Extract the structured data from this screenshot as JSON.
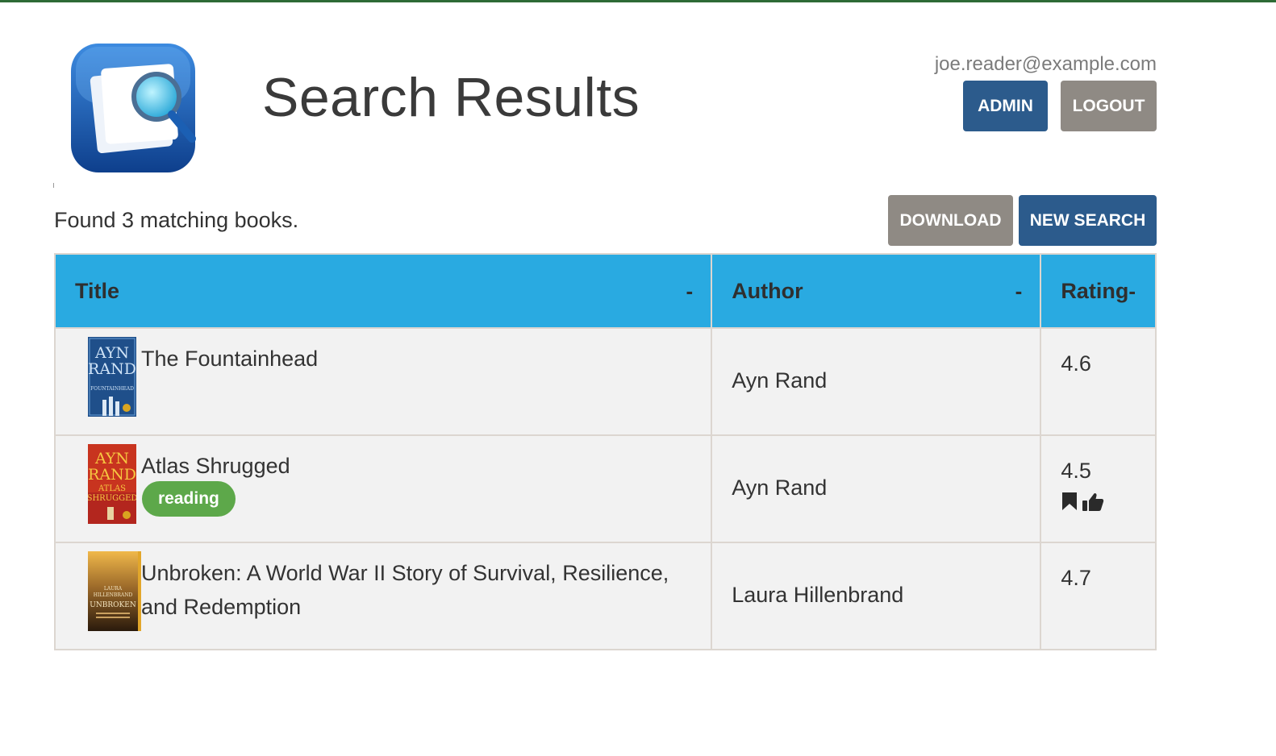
{
  "header": {
    "title": "Search Results",
    "user_email": "joe.reader@example.com",
    "admin_label": "ADMIN",
    "logout_label": "LOGOUT"
  },
  "toolbar": {
    "result_text": "Found 3 matching books.",
    "download_label": "DOWNLOAD",
    "new_search_label": "NEW SEARCH"
  },
  "table": {
    "columns": [
      {
        "label": "Title",
        "sort": "-"
      },
      {
        "label": "Author",
        "sort": "-"
      },
      {
        "label": "Rating",
        "sort": "-"
      }
    ],
    "rows": [
      {
        "title": "The Fountainhead",
        "author": "Ayn Rand",
        "rating": "4.6",
        "badge": "",
        "cover_icon": "fountainhead-cover",
        "status_icons": []
      },
      {
        "title": "Atlas Shrugged",
        "author": "Ayn Rand",
        "rating": "4.5",
        "badge": "reading",
        "cover_icon": "atlas-shrugged-cover",
        "status_icons": [
          "bookmark-icon",
          "thumbs-up-icon"
        ]
      },
      {
        "title": "Unbroken: A World War II Story of Survival, Resilience, and Redemption",
        "author": "Laura Hillenbrand",
        "rating": "4.7",
        "badge": "",
        "cover_icon": "unbroken-cover",
        "status_icons": []
      }
    ]
  },
  "cover_text": {
    "row0": [
      "AYN",
      "RAND",
      "FOUNTAINHEAD"
    ],
    "row1": [
      "AYN",
      "RAND",
      "ATLAS",
      "SHRUGGED"
    ],
    "row2": [
      "LAURA",
      "HILLENBRAND",
      "UNBROKEN"
    ]
  },
  "colors": {
    "header_bg": "#29aae1",
    "primary_button": "#2c5b8c",
    "secondary_button": "#8f8a84",
    "badge_reading": "#5da84a",
    "top_bar": "#2e6b36"
  }
}
